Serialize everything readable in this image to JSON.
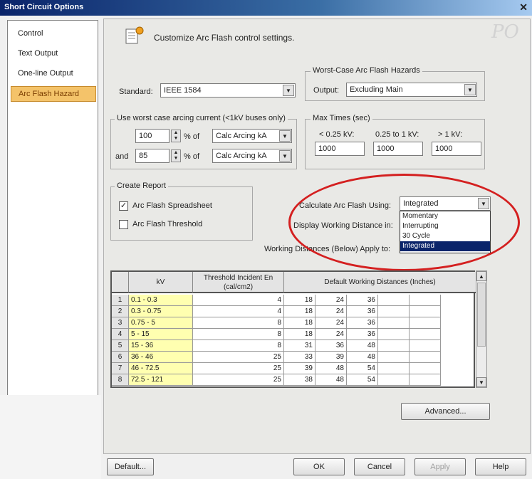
{
  "window": {
    "title": "Short Circuit Options",
    "close_glyph": "✕"
  },
  "sidebar": {
    "items": [
      {
        "label": "Control"
      },
      {
        "label": "Text Output"
      },
      {
        "label": "One-line Output"
      },
      {
        "label": "Arc Flash Hazard"
      }
    ]
  },
  "header": {
    "text": "Customize Arc Flash control settings."
  },
  "standard": {
    "label": "Standard:",
    "value": "IEEE 1584"
  },
  "worst_case": {
    "group_title": "Worst-Case Arc Flash Hazards",
    "output_label": "Output:",
    "output_value": "Excluding Main"
  },
  "arcing": {
    "group_title": "Use worst case arcing current (<1kV buses only)",
    "row1": {
      "value": "100",
      "pct_label": "% of",
      "combo": "Calc Arcing kA"
    },
    "row2": {
      "and_label": "and",
      "value": "85",
      "pct_label": "% of",
      "combo": "Calc Arcing kA"
    }
  },
  "max_times": {
    "group_title": "Max Times (sec)",
    "col1_label": "< 0.25 kV:",
    "col1_value": "1000",
    "col2_label": "0.25 to 1 kV:",
    "col2_value": "1000",
    "col3_label": "> 1 kV:",
    "col3_value": "1000"
  },
  "create_report": {
    "group_title": "Create Report",
    "spreadsheet_label": "Arc Flash Spreadsheet",
    "spreadsheet_checked": "✓",
    "threshold_label": "Arc Flash Threshold"
  },
  "calc_using": {
    "label": "Calculate Arc Flash Using:",
    "value": "Integrated",
    "options": [
      "Momentary",
      "Interrupting",
      "30 Cycle",
      "Integrated"
    ]
  },
  "display_wd": {
    "label": "Display Working Distance in:"
  },
  "wd_apply": {
    "label": "Working Distances (Below) Apply to:"
  },
  "table": {
    "headers": {
      "kv": "kV",
      "threshold": "Threshold Incident En (cal/cm2)",
      "default_wd": "Default Working Distances (Inches)"
    },
    "rows": [
      {
        "n": "1",
        "kv": "0.1 - 0.3",
        "thr": "4",
        "d1": "18",
        "d2": "24",
        "d3": "36"
      },
      {
        "n": "2",
        "kv": "0.3 - 0.75",
        "thr": "4",
        "d1": "18",
        "d2": "24",
        "d3": "36"
      },
      {
        "n": "3",
        "kv": "0.75 - 5",
        "thr": "8",
        "d1": "18",
        "d2": "24",
        "d3": "36"
      },
      {
        "n": "4",
        "kv": "5 - 15",
        "thr": "8",
        "d1": "18",
        "d2": "24",
        "d3": "36"
      },
      {
        "n": "5",
        "kv": "15 - 36",
        "thr": "8",
        "d1": "31",
        "d2": "36",
        "d3": "48"
      },
      {
        "n": "6",
        "kv": "36 - 46",
        "thr": "25",
        "d1": "33",
        "d2": "39",
        "d3": "48"
      },
      {
        "n": "7",
        "kv": "46 - 72.5",
        "thr": "25",
        "d1": "39",
        "d2": "48",
        "d3": "54"
      },
      {
        "n": "8",
        "kv": "72.5 - 121",
        "thr": "25",
        "d1": "38",
        "d2": "48",
        "d3": "54"
      }
    ]
  },
  "buttons": {
    "advanced": "Advanced...",
    "default": "Default...",
    "ok": "OK",
    "cancel": "Cancel",
    "apply": "Apply",
    "help": "Help"
  },
  "glyphs": {
    "down": "▼",
    "up": "▲",
    "up_small": "▲",
    "down_small": "▼"
  },
  "colors": {
    "selection_orange": "#f4c36a",
    "highlight_navy": "#0a246a",
    "oval_red": "#d42020",
    "kv_yellow": "#ffffb0"
  }
}
